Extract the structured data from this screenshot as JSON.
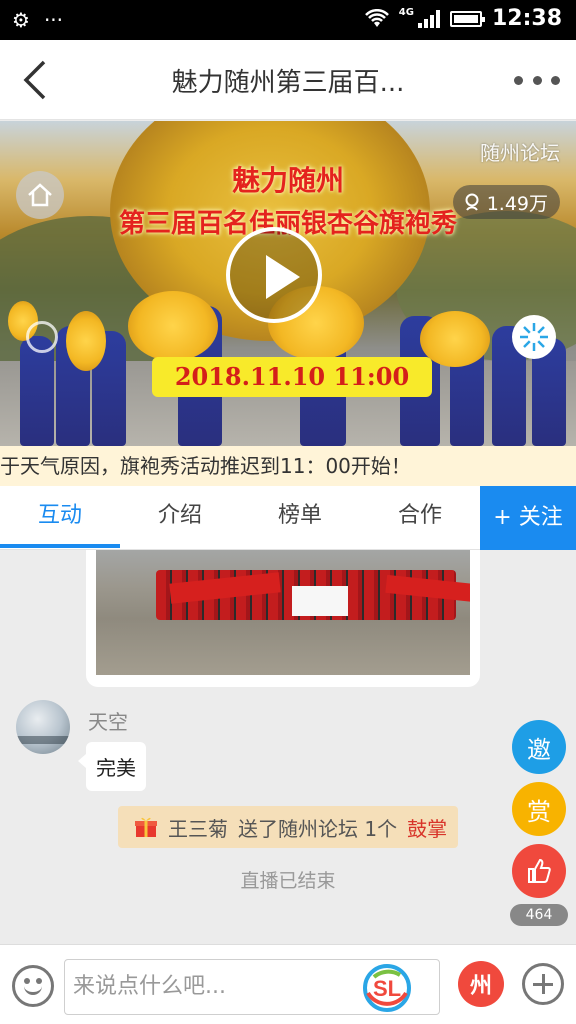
{
  "status_bar": {
    "network": "4G",
    "time": "12:38",
    "icons": [
      "settings-icon",
      "more-dots-icon",
      "wifi-icon",
      "signal-icon",
      "battery-icon"
    ]
  },
  "header": {
    "title": "魅力随州第三届百...",
    "back_icon": "back-arrow-icon",
    "more_icon": "more-dots-icon"
  },
  "video": {
    "source": "随州论坛",
    "views": "1.49万",
    "title_line1": "魅力随州",
    "title_line2": "第三届百名佳丽银杏谷旗袍秀",
    "date": "2018.11.10 11:00"
  },
  "notice": {
    "text": "于天气原因，旗袍秀活动推迟到11：00开始！"
  },
  "tabs": {
    "items": [
      {
        "label": "互动",
        "active": true
      },
      {
        "label": "介绍",
        "active": false
      },
      {
        "label": "榜单",
        "active": false
      },
      {
        "label": "合作",
        "active": false
      }
    ],
    "follow_label": "+ 关注"
  },
  "chat": {
    "username": "天空",
    "message": "完美",
    "gift_sender": "王三菊",
    "gift_text": "送了随州论坛 1个",
    "gift_item": "鼓掌",
    "ended_text": "直播已结束"
  },
  "side_actions": {
    "invite": "邀",
    "reward": "赏",
    "like_count": "464"
  },
  "bottom_bar": {
    "input_placeholder": "来说点什么吧...",
    "logo_text": "SL",
    "gift_glyph": "州"
  },
  "colors": {
    "accent": "#1a8bf0",
    "invite": "#1e9ee6",
    "reward": "#f8b300",
    "like": "#f0493d",
    "notice_bg": "#fff4d8",
    "gift_bg": "#f5dfb9",
    "gift_highlight": "#d8342a"
  }
}
